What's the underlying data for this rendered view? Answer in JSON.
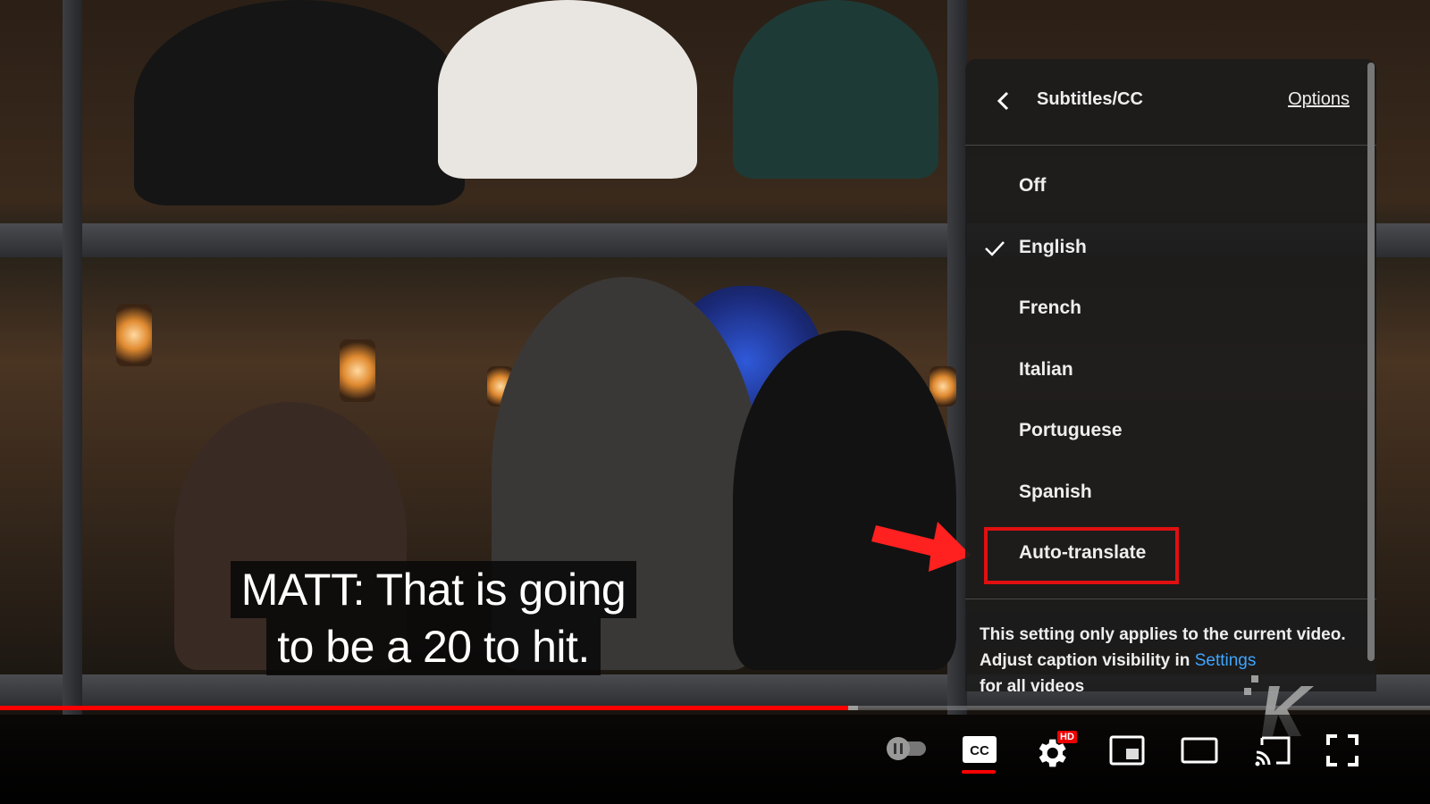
{
  "player": {
    "caption": {
      "line1": "MATT: That is going",
      "line2": "to be a 20 to hit."
    },
    "progress": {
      "played_fraction": 0.593,
      "buffered_fraction": 0.6
    },
    "colors": {
      "accent": "#ff0000",
      "link": "#3ea6ff",
      "menu_bg": "#1c1c1c",
      "annotation": "#e01010"
    }
  },
  "subtitles_menu": {
    "title": "Subtitles/CC",
    "options_label": "Options",
    "items": [
      {
        "label": "Off",
        "selected": false
      },
      {
        "label": "English",
        "selected": true
      },
      {
        "label": "French",
        "selected": false
      },
      {
        "label": "Italian",
        "selected": false
      },
      {
        "label": "Portuguese",
        "selected": false
      },
      {
        "label": "Spanish",
        "selected": false
      },
      {
        "label": "Auto-translate",
        "selected": false,
        "highlighted": true
      }
    ],
    "footer": {
      "text": "This setting only applies to the current video. Adjust caption visibility in ",
      "link_label": "Settings",
      "text_after": " for all videos"
    }
  },
  "controls": {
    "autoplay_icon": "autoplay-toggle-icon",
    "cc_icon": "cc-icon",
    "cc_label": "CC",
    "settings_icon": "gear-icon",
    "quality_badge": "HD",
    "miniplayer_icon": "miniplayer-icon",
    "theater_icon": "theater-mode-icon",
    "cast_icon": "cast-icon",
    "fullscreen_icon": "fullscreen-icon"
  }
}
